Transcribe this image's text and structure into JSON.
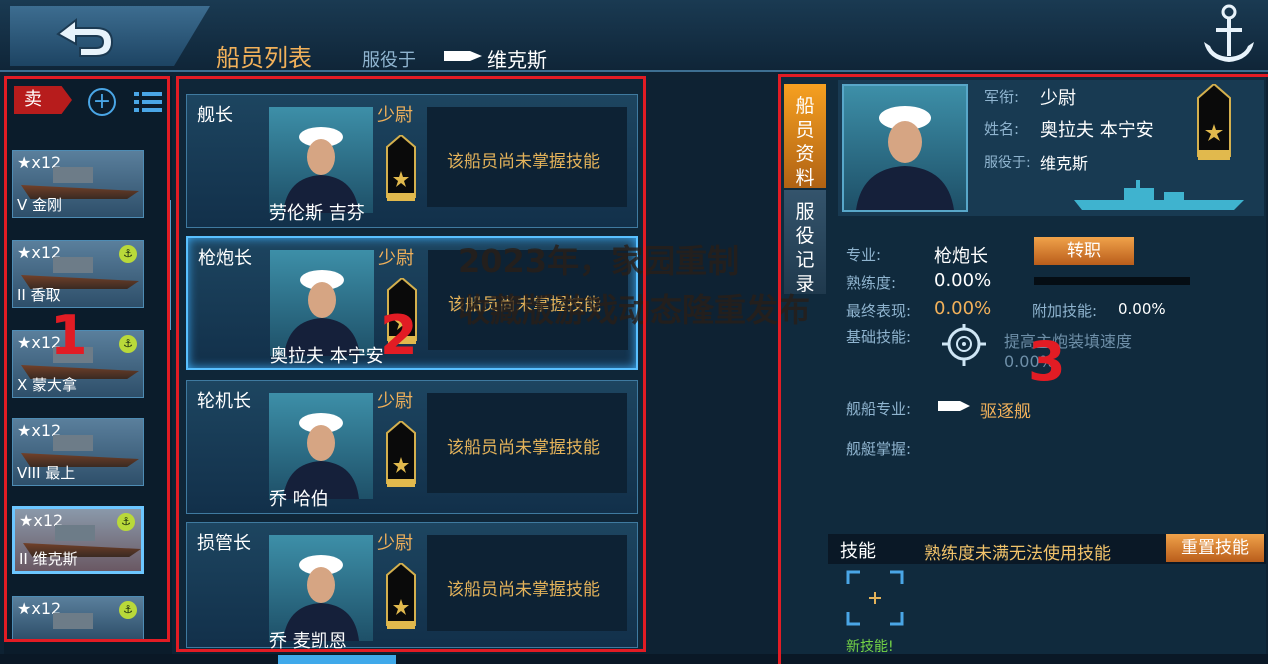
{
  "header": {
    "back_icon": "back-arrow-icon",
    "title": "船员列表",
    "served_label": "服役于",
    "served_ship": "维克斯",
    "anchor_icon": "anchor-icon"
  },
  "list_toolbar": {
    "sell_label": "卖",
    "add_icon": "+",
    "list_icon": "list-icon"
  },
  "ships": [
    {
      "level": "★x12",
      "name": "V 金刚",
      "badge": ""
    },
    {
      "level": "★x12",
      "name": "II 香取",
      "badge": "⚓"
    },
    {
      "level": "★x12",
      "name": "X 蒙大拿",
      "badge": "⚓"
    },
    {
      "level": "★x12",
      "name": "VIII 最上",
      "badge": ""
    },
    {
      "level": "★x12",
      "name": "II 维克斯",
      "badge": "⚓"
    },
    {
      "level": "★x12",
      "name": "",
      "badge": "⚓"
    }
  ],
  "crew": [
    {
      "role": "舰长",
      "rank": "少尉",
      "skill": "该船员尚未掌握技能",
      "name": "劳伦斯 吉芬"
    },
    {
      "role": "枪炮长",
      "rank": "少尉",
      "skill": "该船员尚未掌握技能",
      "name": "奥拉夫 本宁安"
    },
    {
      "role": "轮机长",
      "rank": "少尉",
      "skill": "该船员尚未掌握技能",
      "name": "乔 哈伯"
    },
    {
      "role": "损管长",
      "rank": "少尉",
      "skill": "该船员尚未掌握技能",
      "name": "乔 麦凯恩"
    }
  ],
  "overlay": {
    "line1": "2023年，家园重制",
    "line2": "收藏版游戏动态隆重发布"
  },
  "annotations": {
    "label1": "1",
    "label2": "2",
    "label3": "3"
  },
  "detail": {
    "tab_info": "船员资料",
    "tab_record": "服役记录",
    "rank_label": "军衔:",
    "rank_value": "少尉",
    "name_label": "姓名:",
    "name_value": "奥拉夫 本宁安",
    "served_label": "服役于:",
    "served_value": "维克斯",
    "specialty_label": "专业:",
    "specialty_value": "枪炮长",
    "transfer_button": "转职",
    "proficiency_label": "熟练度:",
    "proficiency_value": "0.00%",
    "proficiency_fraction": 0.0,
    "final_label": "最终表现:",
    "final_value": "0.00%",
    "extra_label": "附加技能:",
    "extra_value": "0.00%",
    "base_skill_label": "基础技能:",
    "base_skill_desc": "提高主炮装填速度0.00%。",
    "ship_spec_label": "舰船专业:",
    "ship_spec_value": "驱逐舰",
    "ship_mastery_label": "舰艇掌握:"
  },
  "skills": {
    "title": "技能",
    "warning": "熟练度未满无法使用技能",
    "reset_button": "重置技能",
    "new_skill_label": "新技能!"
  },
  "colors": {
    "accent": "#f2b15a",
    "selection": "#59c0ff",
    "annotation": "#e21c24"
  }
}
